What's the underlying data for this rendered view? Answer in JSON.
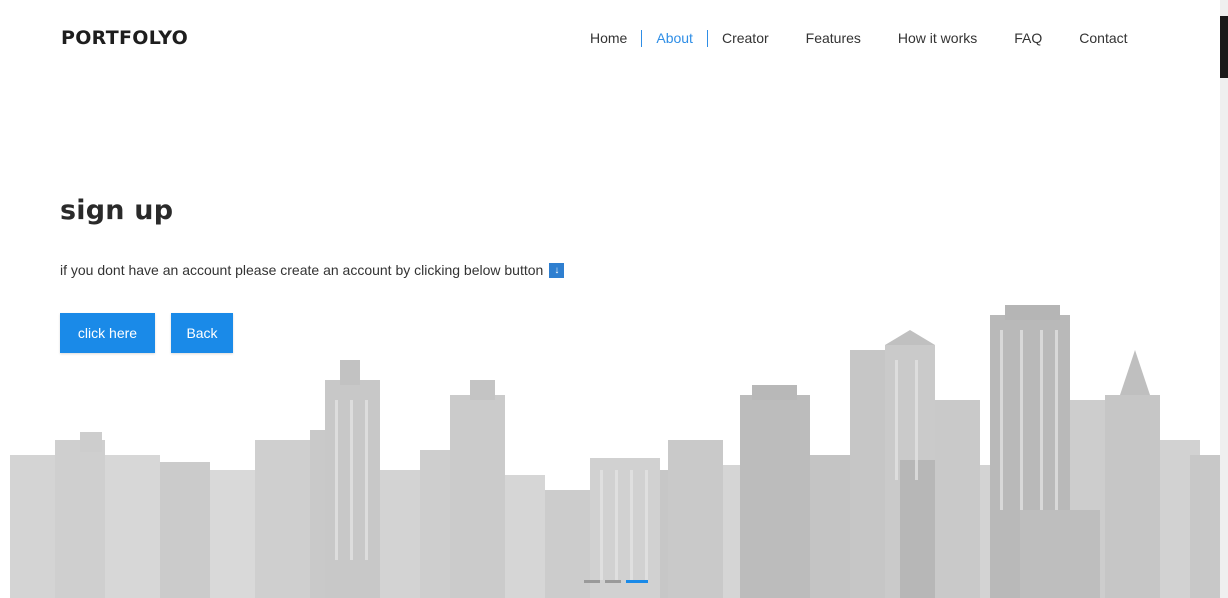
{
  "brand": "PORTFOLYO",
  "nav": {
    "items": [
      "Home",
      "About",
      "Creator",
      "Features",
      "How it works",
      "FAQ",
      "Contact"
    ],
    "active": "About"
  },
  "hero": {
    "title": "sign up",
    "text": "if you dont have an account please create an account by clicking below button",
    "icon": "arrow-down-icon",
    "primary_button": "click here",
    "back_button": "Back"
  },
  "carousel": {
    "slides": 3,
    "active_index": 2
  },
  "colors": {
    "accent": "#1a8ae8",
    "text": "#222222",
    "skyline": "#d9d9d9"
  }
}
